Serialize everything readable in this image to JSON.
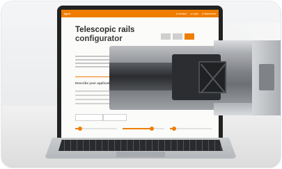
{
  "screen": {
    "logo": "igus",
    "nav": [
      "● Deutsch",
      "● Login",
      "● Warenkorb"
    ],
    "title_line1": "Telescopic rails",
    "title_line2": "configurator",
    "section_label": "Describe your application"
  },
  "colors": {
    "accent": "#ef7d00",
    "screen_bg": "#fbfbfa",
    "laptop_body": "#222222"
  },
  "sliders": [
    {
      "fill_fraction": 0.12
    },
    {
      "fill_fraction": 0.7
    },
    {
      "fill_fraction": 0.1
    }
  ]
}
